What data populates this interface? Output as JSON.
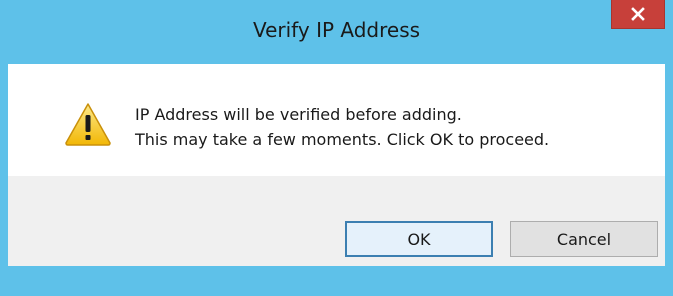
{
  "dialog": {
    "title": "Verify IP Address",
    "close_icon": "close-icon",
    "warning_icon": "warning-icon",
    "message_line_1": "IP Address will be verified before adding.",
    "message_line_2": "This may take a few moments.  Click OK to proceed.",
    "ok_label": "OK",
    "cancel_label": "Cancel"
  },
  "colors": {
    "title_bar": "#5ec1e9",
    "close_button": "#c7403a",
    "content_bg": "#ffffff",
    "footer_bg": "#f0f0f0",
    "warning_yellow": "#f5c518"
  }
}
